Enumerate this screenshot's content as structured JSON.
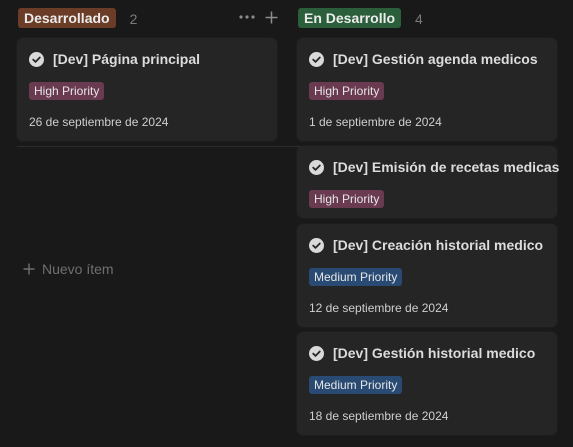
{
  "columns": [
    {
      "status": "Desarrollado",
      "count": "2",
      "status_color": "#6b3c26",
      "new_item_label": "Nuevo ítem",
      "cards": [
        {
          "title": "[Dev] Página principal",
          "priority": "High Priority",
          "date": "26 de septiembre de 2024"
        }
      ]
    },
    {
      "status": "En Desarrollo",
      "count": "4",
      "status_color": "#2b5e3b",
      "cards": [
        {
          "title": "[Dev] Gestión agenda medicos",
          "priority": "High Priority",
          "date": "1 de septiembre de 2024"
        },
        {
          "title": "[Dev] Emisión de recetas medicas",
          "priority": "High Priority",
          "date": ""
        },
        {
          "title": "[Dev] Creación historial medico",
          "priority": "Medium Priority",
          "date": "12 de septiembre de 2024"
        },
        {
          "title": "[Dev] Gestión historial medico",
          "priority": "Medium Priority",
          "date": "18 de septiembre de 2024"
        }
      ]
    }
  ],
  "colors": {
    "background": "#191919",
    "card": "#252525",
    "high_priority": "#693a50",
    "medium_priority": "#294a73"
  },
  "icons": {
    "card_status": "check-circle-icon",
    "more": "more-horizontal-icon",
    "add": "plus-icon"
  }
}
